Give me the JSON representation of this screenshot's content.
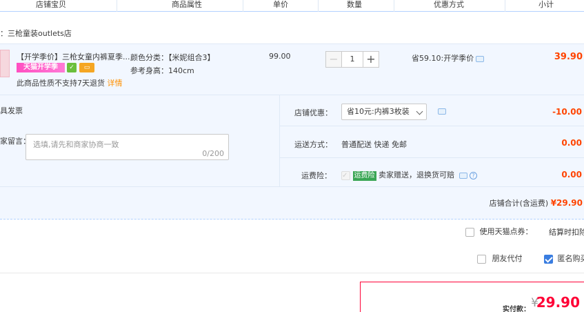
{
  "header": {
    "shop_item": "店铺宝贝",
    "attributes": "商品属性",
    "unit_price": "单价",
    "quantity": "数量",
    "discount": "优惠方式",
    "subtotal": "小计"
  },
  "shop": {
    "name": "：三枪童装outlets店"
  },
  "item": {
    "title": "【开学季价】三枪女童内裤夏季...",
    "promo_badge": "天猫开学季",
    "return_policy": "此商品性质不支持7天退货",
    "detail_link": "详情",
    "attr_color": "颜色分类：【米妮组合3】",
    "attr_height": "参考身高：140cm",
    "price": "99.00",
    "qty_minus": "−",
    "qty_value": "1",
    "qty_plus": "+",
    "discount_text": "省59.10:开学季价",
    "subtotal": "39.90"
  },
  "options": {
    "invoice_label": "具发票",
    "message_label": "家留言：",
    "message_placeholder": "选填,请先和商家协商一致",
    "message_count": "0/200",
    "shop_coupon_label": "店铺优惠：",
    "shop_coupon_selected": "省10元:内裤3枚装",
    "shop_coupon_value": "-10.00",
    "shipping_label": "运送方式：",
    "shipping_text": "普通配送 快递 免邮",
    "shipping_value": "0.00",
    "insurance_label": "运费险：",
    "insurance_badge": "运费险",
    "insurance_text": "卖家赠送，退换货可赔",
    "insurance_value": "0.00",
    "shop_total_label": "店铺合计(含运费)",
    "shop_total_value": "¥29.90"
  },
  "points": {
    "use_points_label": "使用天猫点券：",
    "points_note": "结算时扣除"
  },
  "extras": {
    "friend_pay_label": "朋友代付",
    "anonymous_label": "匿名购买"
  },
  "payment": {
    "label": "实付款：",
    "currency": "¥",
    "amount": "29.90"
  },
  "colors": {
    "accent_red": "#ff4400",
    "pay_red": "#ff0036",
    "row_bg": "#f2f7ff",
    "border_blue": "#b2d1ff"
  }
}
